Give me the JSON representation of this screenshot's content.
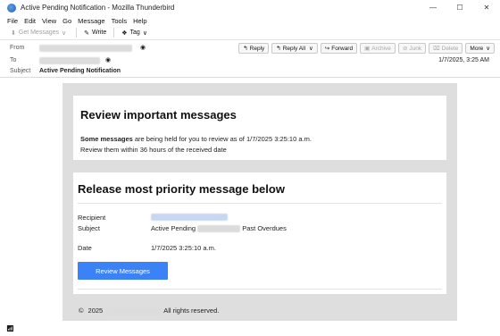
{
  "window": {
    "title": "Active Pending Notification - Mozilla Thunderbird",
    "minimize": "—",
    "maximize": "☐",
    "close": "✕"
  },
  "menu": [
    "File",
    "Edit",
    "View",
    "Go",
    "Message",
    "Tools",
    "Help"
  ],
  "toolbar": {
    "get_messages": "Get Messages",
    "write": "Write",
    "tag": "Tag"
  },
  "header": {
    "from_label": "From",
    "to_label": "To",
    "subject_label": "Subject",
    "subject_value": "Active Pending Notification",
    "date": "1/7/2025, 3:25 AM",
    "actions": {
      "reply": "Reply",
      "reply_all": "Reply All",
      "forward": "Forward",
      "archive": "Archive",
      "junk": "Junk",
      "delete": "Delete",
      "more": "More"
    }
  },
  "email": {
    "card1_title": "Review important messages",
    "card1_bold": "Some messages",
    "card1_line1_rest": " are being held for you to review as of 1/7/2025 3:25:10 a.m.",
    "card1_line2": "Review them within 36 hours of the received date",
    "card2_title": "Release most priority message below",
    "recipient_label": "Recipient",
    "subject_label": "Subject",
    "subject_value_prefix": "Active Pending",
    "subject_value_suffix": "Past Overdues",
    "date_label": "Date",
    "date_value": "1/7/2025 3:25:10 a.m.",
    "button_label": "Review Messages",
    "footer_symbol": "©",
    "footer_year": "2025",
    "footer_rights": "All rights reserved."
  },
  "colors": {
    "accent": "#3b82f6",
    "background_frame": "#dedede"
  }
}
